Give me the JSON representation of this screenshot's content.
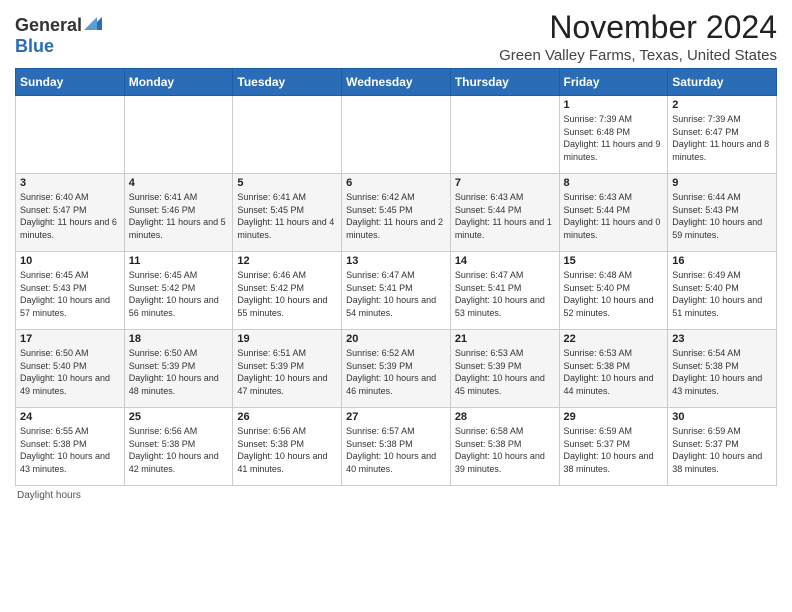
{
  "header": {
    "logo_general": "General",
    "logo_blue": "Blue",
    "month_title": "November 2024",
    "subtitle": "Green Valley Farms, Texas, United States"
  },
  "days_header": [
    "Sunday",
    "Monday",
    "Tuesday",
    "Wednesday",
    "Thursday",
    "Friday",
    "Saturday"
  ],
  "footer": {
    "daylight_hours": "Daylight hours"
  },
  "weeks": [
    [
      {
        "day": "",
        "info": ""
      },
      {
        "day": "",
        "info": ""
      },
      {
        "day": "",
        "info": ""
      },
      {
        "day": "",
        "info": ""
      },
      {
        "day": "",
        "info": ""
      },
      {
        "day": "1",
        "info": "Sunrise: 7:39 AM\nSunset: 6:48 PM\nDaylight: 11 hours and 9 minutes."
      },
      {
        "day": "2",
        "info": "Sunrise: 7:39 AM\nSunset: 6:47 PM\nDaylight: 11 hours and 8 minutes."
      }
    ],
    [
      {
        "day": "3",
        "info": "Sunrise: 6:40 AM\nSunset: 5:47 PM\nDaylight: 11 hours and 6 minutes."
      },
      {
        "day": "4",
        "info": "Sunrise: 6:41 AM\nSunset: 5:46 PM\nDaylight: 11 hours and 5 minutes."
      },
      {
        "day": "5",
        "info": "Sunrise: 6:41 AM\nSunset: 5:45 PM\nDaylight: 11 hours and 4 minutes."
      },
      {
        "day": "6",
        "info": "Sunrise: 6:42 AM\nSunset: 5:45 PM\nDaylight: 11 hours and 2 minutes."
      },
      {
        "day": "7",
        "info": "Sunrise: 6:43 AM\nSunset: 5:44 PM\nDaylight: 11 hours and 1 minute."
      },
      {
        "day": "8",
        "info": "Sunrise: 6:43 AM\nSunset: 5:44 PM\nDaylight: 11 hours and 0 minutes."
      },
      {
        "day": "9",
        "info": "Sunrise: 6:44 AM\nSunset: 5:43 PM\nDaylight: 10 hours and 59 minutes."
      }
    ],
    [
      {
        "day": "10",
        "info": "Sunrise: 6:45 AM\nSunset: 5:43 PM\nDaylight: 10 hours and 57 minutes."
      },
      {
        "day": "11",
        "info": "Sunrise: 6:45 AM\nSunset: 5:42 PM\nDaylight: 10 hours and 56 minutes."
      },
      {
        "day": "12",
        "info": "Sunrise: 6:46 AM\nSunset: 5:42 PM\nDaylight: 10 hours and 55 minutes."
      },
      {
        "day": "13",
        "info": "Sunrise: 6:47 AM\nSunset: 5:41 PM\nDaylight: 10 hours and 54 minutes."
      },
      {
        "day": "14",
        "info": "Sunrise: 6:47 AM\nSunset: 5:41 PM\nDaylight: 10 hours and 53 minutes."
      },
      {
        "day": "15",
        "info": "Sunrise: 6:48 AM\nSunset: 5:40 PM\nDaylight: 10 hours and 52 minutes."
      },
      {
        "day": "16",
        "info": "Sunrise: 6:49 AM\nSunset: 5:40 PM\nDaylight: 10 hours and 51 minutes."
      }
    ],
    [
      {
        "day": "17",
        "info": "Sunrise: 6:50 AM\nSunset: 5:40 PM\nDaylight: 10 hours and 49 minutes."
      },
      {
        "day": "18",
        "info": "Sunrise: 6:50 AM\nSunset: 5:39 PM\nDaylight: 10 hours and 48 minutes."
      },
      {
        "day": "19",
        "info": "Sunrise: 6:51 AM\nSunset: 5:39 PM\nDaylight: 10 hours and 47 minutes."
      },
      {
        "day": "20",
        "info": "Sunrise: 6:52 AM\nSunset: 5:39 PM\nDaylight: 10 hours and 46 minutes."
      },
      {
        "day": "21",
        "info": "Sunrise: 6:53 AM\nSunset: 5:39 PM\nDaylight: 10 hours and 45 minutes."
      },
      {
        "day": "22",
        "info": "Sunrise: 6:53 AM\nSunset: 5:38 PM\nDaylight: 10 hours and 44 minutes."
      },
      {
        "day": "23",
        "info": "Sunrise: 6:54 AM\nSunset: 5:38 PM\nDaylight: 10 hours and 43 minutes."
      }
    ],
    [
      {
        "day": "24",
        "info": "Sunrise: 6:55 AM\nSunset: 5:38 PM\nDaylight: 10 hours and 43 minutes."
      },
      {
        "day": "25",
        "info": "Sunrise: 6:56 AM\nSunset: 5:38 PM\nDaylight: 10 hours and 42 minutes."
      },
      {
        "day": "26",
        "info": "Sunrise: 6:56 AM\nSunset: 5:38 PM\nDaylight: 10 hours and 41 minutes."
      },
      {
        "day": "27",
        "info": "Sunrise: 6:57 AM\nSunset: 5:38 PM\nDaylight: 10 hours and 40 minutes."
      },
      {
        "day": "28",
        "info": "Sunrise: 6:58 AM\nSunset: 5:38 PM\nDaylight: 10 hours and 39 minutes."
      },
      {
        "day": "29",
        "info": "Sunrise: 6:59 AM\nSunset: 5:37 PM\nDaylight: 10 hours and 38 minutes."
      },
      {
        "day": "30",
        "info": "Sunrise: 6:59 AM\nSunset: 5:37 PM\nDaylight: 10 hours and 38 minutes."
      }
    ]
  ]
}
